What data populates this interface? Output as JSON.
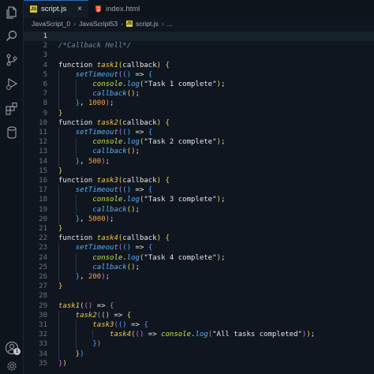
{
  "tabs": [
    {
      "label": "script.js",
      "icon": "js-icon",
      "active": true,
      "close": "×"
    },
    {
      "label": "index.html",
      "icon": "html5-icon",
      "active": false
    }
  ],
  "breadcrumb": [
    "JavaScript_0",
    "JavaScript53",
    "script.js",
    "..."
  ],
  "activity_bar": [
    "explorer-icon",
    "search-icon",
    "source-control-icon",
    "run-debug-icon",
    "extensions-icon",
    "database-icon"
  ],
  "accounts_badge": "1",
  "editor": {
    "current_line": 1,
    "lines": [
      {
        "n": "1",
        "t": []
      },
      {
        "n": "2",
        "t": [
          [
            "cmt",
            "/*Callback Hell*/"
          ]
        ]
      },
      {
        "n": "3",
        "t": []
      },
      {
        "n": "4",
        "t": [
          [
            "kw",
            "function "
          ],
          [
            "fn",
            "task1"
          ],
          [
            "p1",
            "("
          ],
          [
            "plain",
            "callback"
          ],
          [
            "p1",
            ")"
          ],
          [
            "plain",
            " "
          ],
          [
            "p1",
            "{"
          ]
        ]
      },
      {
        "n": "5",
        "i": 1,
        "t": [
          [
            "call",
            "setTimeout"
          ],
          [
            "p2",
            "("
          ],
          [
            "p3",
            "()"
          ],
          [
            "plain",
            " => "
          ],
          [
            "p3",
            "{"
          ]
        ]
      },
      {
        "n": "6",
        "i": 2,
        "t": [
          [
            "obj",
            "console"
          ],
          [
            "plain",
            "."
          ],
          [
            "call",
            "log"
          ],
          [
            "p1",
            "("
          ],
          [
            "str",
            "\"Task 1 complete\""
          ],
          [
            "p1",
            ")"
          ],
          [
            "plain",
            ";"
          ]
        ]
      },
      {
        "n": "7",
        "i": 2,
        "t": [
          [
            "call",
            "callback"
          ],
          [
            "p1",
            "()"
          ],
          [
            "plain",
            ";"
          ]
        ]
      },
      {
        "n": "8",
        "i": 1,
        "t": [
          [
            "p3",
            "}"
          ],
          [
            "plain",
            ", "
          ],
          [
            "num",
            "1000"
          ],
          [
            "p2",
            ")"
          ],
          [
            "plain",
            ";"
          ]
        ]
      },
      {
        "n": "9",
        "t": [
          [
            "p1",
            "}"
          ]
        ]
      },
      {
        "n": "10",
        "t": [
          [
            "kw",
            "function "
          ],
          [
            "fn",
            "task2"
          ],
          [
            "p1",
            "("
          ],
          [
            "plain",
            "callback"
          ],
          [
            "p1",
            ")"
          ],
          [
            "plain",
            " "
          ],
          [
            "p1",
            "{"
          ]
        ]
      },
      {
        "n": "11",
        "i": 1,
        "t": [
          [
            "call",
            "setTimeout"
          ],
          [
            "p2",
            "("
          ],
          [
            "p3",
            "()"
          ],
          [
            "plain",
            " => "
          ],
          [
            "p3",
            "{"
          ]
        ]
      },
      {
        "n": "12",
        "i": 2,
        "t": [
          [
            "obj",
            "console"
          ],
          [
            "plain",
            "."
          ],
          [
            "call",
            "log"
          ],
          [
            "p1",
            "("
          ],
          [
            "str",
            "\"Task 2 complete\""
          ],
          [
            "p1",
            ")"
          ],
          [
            "plain",
            ";"
          ]
        ]
      },
      {
        "n": "13",
        "i": 2,
        "t": [
          [
            "call",
            "callback"
          ],
          [
            "p1",
            "()"
          ],
          [
            "plain",
            ";"
          ]
        ]
      },
      {
        "n": "14",
        "i": 1,
        "t": [
          [
            "p3",
            "}"
          ],
          [
            "plain",
            ", "
          ],
          [
            "num",
            "500"
          ],
          [
            "p2",
            ")"
          ],
          [
            "plain",
            ";"
          ]
        ]
      },
      {
        "n": "15",
        "t": [
          [
            "p1",
            "}"
          ]
        ]
      },
      {
        "n": "16",
        "t": [
          [
            "kw",
            "function "
          ],
          [
            "fn",
            "task3"
          ],
          [
            "p1",
            "("
          ],
          [
            "plain",
            "callback"
          ],
          [
            "p1",
            ")"
          ],
          [
            "plain",
            " "
          ],
          [
            "p1",
            "{"
          ]
        ]
      },
      {
        "n": "17",
        "i": 1,
        "t": [
          [
            "call",
            "setTimeout"
          ],
          [
            "p2",
            "("
          ],
          [
            "p3",
            "()"
          ],
          [
            "plain",
            " => "
          ],
          [
            "p3",
            "{"
          ]
        ]
      },
      {
        "n": "18",
        "i": 2,
        "t": [
          [
            "obj",
            "console"
          ],
          [
            "plain",
            "."
          ],
          [
            "call",
            "log"
          ],
          [
            "p1",
            "("
          ],
          [
            "str",
            "\"Task 3 complete\""
          ],
          [
            "p1",
            ")"
          ],
          [
            "plain",
            ";"
          ]
        ]
      },
      {
        "n": "19",
        "i": 2,
        "t": [
          [
            "call",
            "callback"
          ],
          [
            "p1",
            "()"
          ],
          [
            "plain",
            ";"
          ]
        ]
      },
      {
        "n": "20",
        "i": 1,
        "t": [
          [
            "p3",
            "}"
          ],
          [
            "plain",
            ", "
          ],
          [
            "num",
            "5000"
          ],
          [
            "p2",
            ")"
          ],
          [
            "plain",
            ";"
          ]
        ]
      },
      {
        "n": "21",
        "t": [
          [
            "p1",
            "}"
          ]
        ]
      },
      {
        "n": "22",
        "t": [
          [
            "kw",
            "function "
          ],
          [
            "fn",
            "task4"
          ],
          [
            "p1",
            "("
          ],
          [
            "plain",
            "callback"
          ],
          [
            "p1",
            ")"
          ],
          [
            "plain",
            " "
          ],
          [
            "p1",
            "{"
          ]
        ]
      },
      {
        "n": "23",
        "i": 1,
        "t": [
          [
            "call",
            "setTimeout"
          ],
          [
            "p2",
            "("
          ],
          [
            "p3",
            "()"
          ],
          [
            "plain",
            " => "
          ],
          [
            "p3",
            "{"
          ]
        ]
      },
      {
        "n": "24",
        "i": 2,
        "t": [
          [
            "obj",
            "console"
          ],
          [
            "plain",
            "."
          ],
          [
            "call",
            "log"
          ],
          [
            "p1",
            "("
          ],
          [
            "str",
            "\"Task 4 complete\""
          ],
          [
            "p1",
            ")"
          ],
          [
            "plain",
            ";"
          ]
        ]
      },
      {
        "n": "25",
        "i": 2,
        "t": [
          [
            "call",
            "callback"
          ],
          [
            "p1",
            "()"
          ],
          [
            "plain",
            ";"
          ]
        ]
      },
      {
        "n": "26",
        "i": 1,
        "t": [
          [
            "p3",
            "}"
          ],
          [
            "plain",
            ", "
          ],
          [
            "num",
            "200"
          ],
          [
            "p2",
            ")"
          ],
          [
            "plain",
            ";"
          ]
        ]
      },
      {
        "n": "27",
        "t": [
          [
            "p1",
            "}"
          ]
        ]
      },
      {
        "n": "28",
        "t": []
      },
      {
        "n": "29",
        "t": [
          [
            "fn",
            "task1"
          ],
          [
            "p1",
            "("
          ],
          [
            "p2",
            "()"
          ],
          [
            "plain",
            " => "
          ],
          [
            "p2",
            "{"
          ]
        ]
      },
      {
        "n": "30",
        "i": 1,
        "t": [
          [
            "fn",
            "task2"
          ],
          [
            "p3",
            "("
          ],
          [
            "p1",
            "()"
          ],
          [
            "plain",
            " => "
          ],
          [
            "p1",
            "{"
          ]
        ]
      },
      {
        "n": "31",
        "i": 2,
        "t": [
          [
            "fn",
            "task3"
          ],
          [
            "p2",
            "("
          ],
          [
            "p3",
            "()"
          ],
          [
            "plain",
            " => "
          ],
          [
            "p3",
            "{"
          ]
        ]
      },
      {
        "n": "32",
        "i": 3,
        "t": [
          [
            "fn",
            "task4"
          ],
          [
            "p1",
            "("
          ],
          [
            "p2",
            "()"
          ],
          [
            "plain",
            " => "
          ],
          [
            "obj",
            "console"
          ],
          [
            "plain",
            "."
          ],
          [
            "call",
            "log"
          ],
          [
            "p2",
            "("
          ],
          [
            "str",
            "\"All tasks completed\""
          ],
          [
            "p2",
            ")"
          ],
          [
            "p1",
            ")"
          ],
          [
            "plain",
            ";"
          ]
        ]
      },
      {
        "n": "33",
        "i": 2,
        "t": [
          [
            "p3",
            "}"
          ],
          [
            "p2",
            ")"
          ]
        ]
      },
      {
        "n": "34",
        "i": 1,
        "t": [
          [
            "p1",
            "}"
          ],
          [
            "p3",
            ")"
          ]
        ]
      },
      {
        "n": "35",
        "t": [
          [
            "p2",
            "}"
          ],
          [
            "p1",
            ")"
          ]
        ]
      }
    ]
  }
}
